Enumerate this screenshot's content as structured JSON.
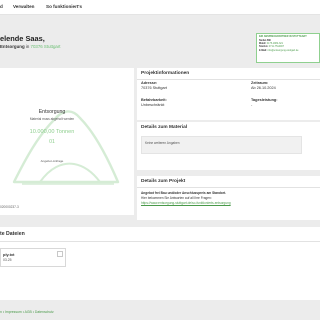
{
  "nav": {
    "items": [
      "d",
      "Verwalten",
      "So funktioniert's"
    ]
  },
  "header": {
    "title": "elende Saas,",
    "subline_prefix": "Entsorgung",
    "subline_in": " in ",
    "subline_location": "70376 Stuttgart"
  },
  "contact": {
    "title": "IHR ANSPRECHPARTNER IN STUTTGART",
    "lines": [
      {
        "label": "Stefan Bill",
        "value": ""
      },
      {
        "label": "Mobil:",
        "value": "0175-1982-321"
      },
      {
        "label": "Telefon:",
        "value": "0711-7514007"
      },
      {
        "label": "E-Mail:",
        "value": "info@entsorgung-stuttgart.de"
      }
    ]
  },
  "overlay": {
    "title": "Entsorgung",
    "description": "Material muss abgeholt werden",
    "amount": "10.000,00 Tonnen",
    "price": "01",
    "request_label": "Angebot-Anfrage"
  },
  "order_id": "020000237-3",
  "project_info": {
    "title": "Projektinformationen",
    "address_label": "Adresse:",
    "address_value": "70376 Stuttgart",
    "period_label": "Zeitraum:",
    "period_value": "Ab 26.10.2024",
    "vehicle_label": "Befahrbarkeit:",
    "vehicle_value": "Unbeschränkt",
    "daily_label": "Tagesleistung:",
    "daily_value": "-"
  },
  "material_details": {
    "title": "Details zum Material",
    "text": "Keine weiteren Angaben"
  },
  "project_details": {
    "title": "Details zum Projekt",
    "line1": "Angebot frei Bau und/oder Anschlusspreis am Standort.",
    "line2": "Hier bekommen Sie Antworten auf all Ihre Fragen:",
    "link": "https://www.entsorgung-stuttgart.de/so-funktionierts-entsorgung"
  },
  "files": {
    "title": "te Dateien",
    "items": [
      {
        "name": "ply.txt",
        "date": "03.25"
      }
    ]
  },
  "footer": {
    "links": [
      "n",
      "Impressum",
      "AGB",
      "Datenschutz"
    ],
    "separator": " • "
  },
  "colors": {
    "accent": "#6bbf73",
    "sketch": "#d5ecd5"
  }
}
